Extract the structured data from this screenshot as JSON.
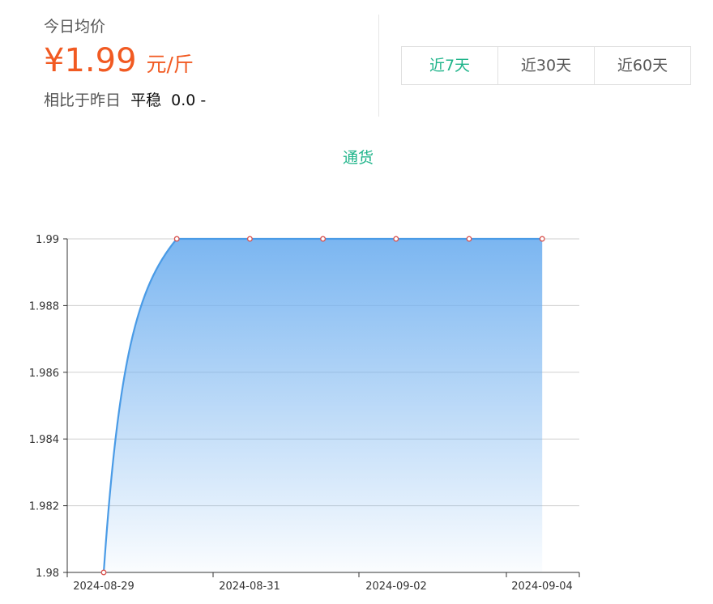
{
  "summary": {
    "label": "今日均价",
    "price": "¥1.99",
    "unit": "元/斤",
    "compare_label": "相比于昨日",
    "compare_status": "平稳",
    "compare_change": "0.0 -"
  },
  "range_tabs": [
    {
      "label": "近7天",
      "active": true
    },
    {
      "label": "近30天",
      "active": false
    },
    {
      "label": "近60天",
      "active": false
    }
  ],
  "colors": {
    "accent": "#1fb48a",
    "price": "#f15a22",
    "line": "#4a9be6",
    "area_top": "#74b2f0",
    "point": "#d9534f"
  },
  "chart_data": {
    "type": "area",
    "title": "通货",
    "x": [
      "2024-08-29",
      "2024-08-30",
      "2024-08-31",
      "2024-09-01",
      "2024-09-02",
      "2024-09-03",
      "2024-09-04"
    ],
    "x_tick_labels": [
      "2024-08-29",
      "2024-08-31",
      "2024-09-02",
      "2024-09-04"
    ],
    "series": [
      {
        "values": [
          1.98,
          1.99,
          1.99,
          1.99,
          1.99,
          1.99,
          1.99
        ]
      }
    ],
    "ylim": [
      1.98,
      1.99
    ],
    "y_ticks": [
      "1.98",
      "1.982",
      "1.984",
      "1.986",
      "1.988",
      "1.99"
    ],
    "grid": true,
    "smooth": true
  }
}
